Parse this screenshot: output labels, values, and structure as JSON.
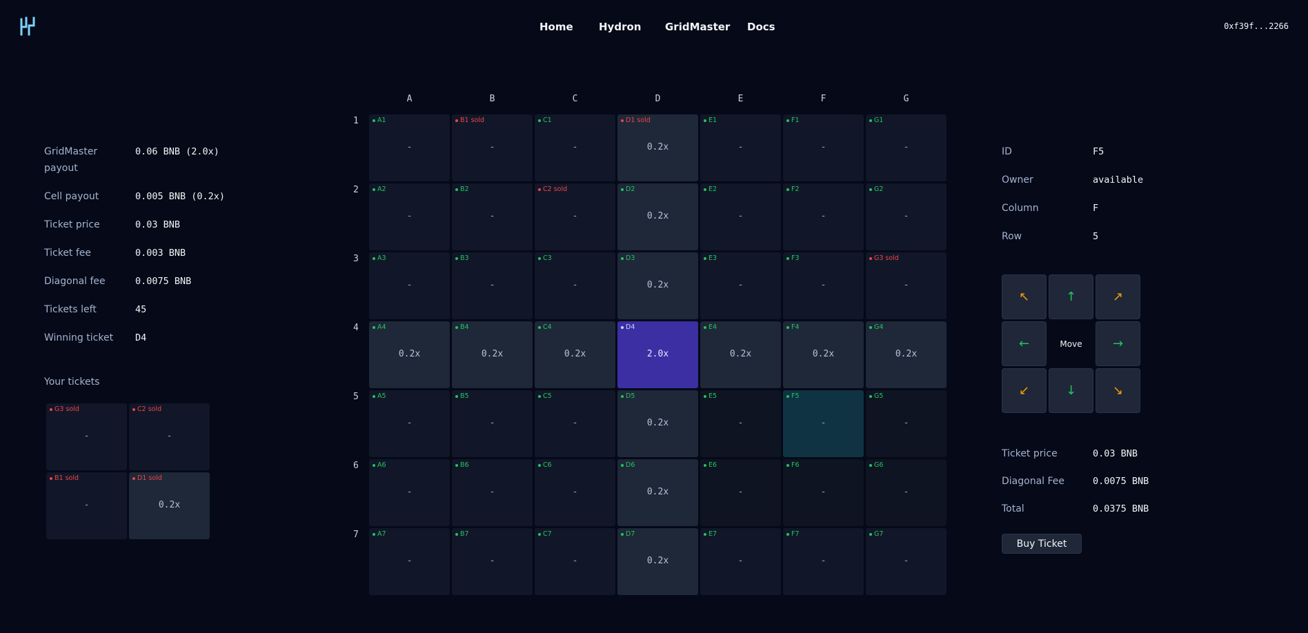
{
  "nav": {
    "items": [
      "Home",
      "Hydron",
      "GridMaster",
      "Docs"
    ],
    "wallet": "0xf39f...2266"
  },
  "stats": [
    {
      "label": "GridMaster payout",
      "value": "0.06 BNB (2.0x)"
    },
    {
      "label": "Cell payout",
      "value": "0.005 BNB (0.2x)"
    },
    {
      "label": "Ticket price",
      "value": "0.03 BNB"
    },
    {
      "label": "Ticket fee",
      "value": "0.003 BNB"
    },
    {
      "label": "Diagonal fee",
      "value": "0.0075 BNB"
    },
    {
      "label": "Tickets left",
      "value": "45"
    },
    {
      "label": "Winning ticket",
      "value": "D4"
    }
  ],
  "your_tickets": {
    "title": "Your tickets",
    "cells": [
      {
        "label": "G3 sold",
        "value": "-",
        "sold": true,
        "lit": false
      },
      {
        "label": "C2 sold",
        "value": "-",
        "sold": true,
        "lit": false
      },
      {
        "label": "B1 sold",
        "value": "-",
        "sold": true,
        "lit": false
      },
      {
        "label": "D1 sold",
        "value": "0.2x",
        "sold": true,
        "lit": true
      }
    ]
  },
  "grid": {
    "columns": [
      "A",
      "B",
      "C",
      "D",
      "E",
      "F",
      "G"
    ],
    "rows": [
      "1",
      "2",
      "3",
      "4",
      "5",
      "6",
      "7"
    ],
    "cells": [
      [
        {
          "label": "A1",
          "value": "-"
        },
        {
          "label": "B1 sold",
          "value": "-",
          "sold": true
        },
        {
          "label": "C1",
          "value": "-"
        },
        {
          "label": "D1 sold",
          "value": "0.2x",
          "sold": true,
          "lit": true
        },
        {
          "label": "E1",
          "value": "-"
        },
        {
          "label": "F1",
          "value": "-"
        },
        {
          "label": "G1",
          "value": "-"
        }
      ],
      [
        {
          "label": "A2",
          "value": "-"
        },
        {
          "label": "B2",
          "value": "-"
        },
        {
          "label": "C2 sold",
          "value": "-",
          "sold": true
        },
        {
          "label": "D2",
          "value": "0.2x",
          "lit": true
        },
        {
          "label": "E2",
          "value": "-"
        },
        {
          "label": "F2",
          "value": "-"
        },
        {
          "label": "G2",
          "value": "-"
        }
      ],
      [
        {
          "label": "A3",
          "value": "-"
        },
        {
          "label": "B3",
          "value": "-"
        },
        {
          "label": "C3",
          "value": "-"
        },
        {
          "label": "D3",
          "value": "0.2x",
          "lit": true
        },
        {
          "label": "E3",
          "value": "-"
        },
        {
          "label": "F3",
          "value": "-"
        },
        {
          "label": "G3 sold",
          "value": "-",
          "sold": true
        }
      ],
      [
        {
          "label": "A4",
          "value": "0.2x",
          "lit": true
        },
        {
          "label": "B4",
          "value": "0.2x",
          "lit": true
        },
        {
          "label": "C4",
          "value": "0.2x",
          "lit": true
        },
        {
          "label": "D4",
          "value": "2.0x",
          "win": true
        },
        {
          "label": "E4",
          "value": "0.2x",
          "lit": true
        },
        {
          "label": "F4",
          "value": "0.2x",
          "lit": true
        },
        {
          "label": "G4",
          "value": "0.2x",
          "lit": true
        }
      ],
      [
        {
          "label": "A5",
          "value": "-"
        },
        {
          "label": "B5",
          "value": "-"
        },
        {
          "label": "C5",
          "value": "-"
        },
        {
          "label": "D5",
          "value": "0.2x",
          "lit": true
        },
        {
          "label": "E5",
          "value": "-",
          "dim": true
        },
        {
          "label": "F5",
          "value": "-",
          "sel": true
        },
        {
          "label": "G5",
          "value": "-",
          "dim": true
        }
      ],
      [
        {
          "label": "A6",
          "value": "-"
        },
        {
          "label": "B6",
          "value": "-"
        },
        {
          "label": "C6",
          "value": "-"
        },
        {
          "label": "D6",
          "value": "0.2x",
          "lit": true
        },
        {
          "label": "E6",
          "value": "-",
          "dim": true
        },
        {
          "label": "F6",
          "value": "-",
          "dim": true
        },
        {
          "label": "G6",
          "value": "-",
          "dim": true
        }
      ],
      [
        {
          "label": "A7",
          "value": "-"
        },
        {
          "label": "B7",
          "value": "-"
        },
        {
          "label": "C7",
          "value": "-"
        },
        {
          "label": "D7",
          "value": "0.2x",
          "lit": true
        },
        {
          "label": "E7",
          "value": "-"
        },
        {
          "label": "F7",
          "value": "-"
        },
        {
          "label": "G7",
          "value": "-"
        }
      ]
    ]
  },
  "selected": [
    {
      "label": "ID",
      "value": "F5"
    },
    {
      "label": "Owner",
      "value": "available"
    },
    {
      "label": "Column",
      "value": "F"
    },
    {
      "label": "Row",
      "value": "5"
    }
  ],
  "move": {
    "label": "Move",
    "up_left": "↖",
    "up": "↑",
    "up_right": "↗",
    "left": "←",
    "right": "→",
    "down_left": "↙",
    "down": "↓",
    "down_right": "↘"
  },
  "cost": [
    {
      "label": "Ticket price",
      "value": "0.03 BNB"
    },
    {
      "label": "Diagonal Fee",
      "value": "0.0075 BNB"
    },
    {
      "label": "Total",
      "value": "0.0375 BNB"
    }
  ],
  "buy_label": "Buy Ticket",
  "colors": {
    "background": "#050918",
    "available": "#22c55e",
    "sold": "#ef4444",
    "winning": "#3b2fa3",
    "selected": "#0f3343",
    "diagonal_arrow": "#f59e0b"
  }
}
